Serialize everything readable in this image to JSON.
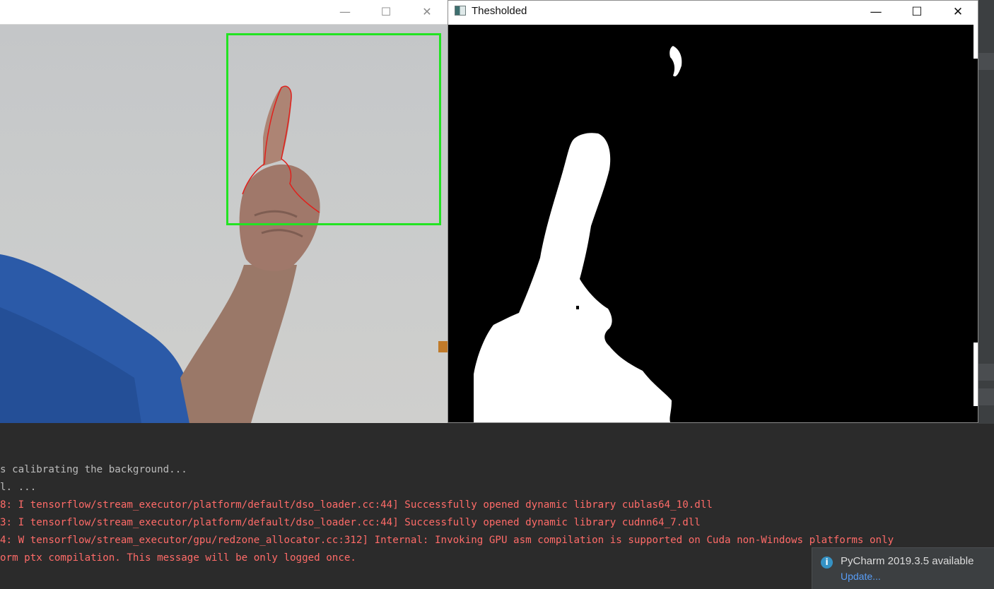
{
  "left_window": {
    "controls": {
      "minimize": "—",
      "maximize": "☐",
      "close": "✕"
    }
  },
  "threshold_window": {
    "title": "Thesholded",
    "controls": {
      "minimize": "—",
      "maximize": "☐",
      "close": "✕"
    }
  },
  "console": {
    "lines": [
      {
        "text": "s calibrating the background...",
        "kind": "plain"
      },
      {
        "text": "l. ...",
        "kind": "plain"
      },
      {
        "text": "8: I tensorflow/stream_executor/platform/default/dso_loader.cc:44] Successfully opened dynamic library cublas64_10.dll",
        "kind": "error"
      },
      {
        "text": "3: I tensorflow/stream_executor/platform/default/dso_loader.cc:44] Successfully opened dynamic library cudnn64_7.dll",
        "kind": "error"
      },
      {
        "text": "4: W tensorflow/stream_executor/gpu/redzone_allocator.cc:312] Internal: Invoking GPU asm compilation is supported on Cuda non-Windows platforms only",
        "kind": "error"
      },
      {
        "text": "orm ptx compilation. This message will be only logged once.",
        "kind": "error"
      }
    ]
  },
  "notification": {
    "title": "PyCharm 2019.3.5 available",
    "link": "Update..."
  },
  "colors": {
    "roi_box": "#22e322",
    "contour": "#e0201c",
    "error_text": "#ff6b68",
    "plain_text": "#bbbbbb",
    "link": "#589df6"
  }
}
